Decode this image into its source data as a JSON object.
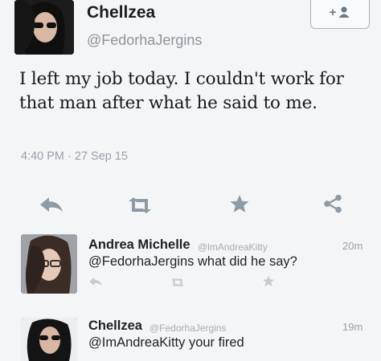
{
  "main_tweet": {
    "display_name": "Chellzea",
    "handle": "@FedorhaJergins",
    "follow_label": "+",
    "text": "I left my job today. I couldn't work for that man after what he said to me.",
    "timestamp": "4:40 PM · 27 Sep 15",
    "actions": [
      "reply-icon",
      "retweet-icon",
      "favorite-icon",
      "share-icon"
    ]
  },
  "replies": [
    {
      "display_name": "Andrea Michelle",
      "handle": "@lmAndreaKitty",
      "text": "@FedorhaJergins what did he say?",
      "time": "20m"
    },
    {
      "display_name": "Chellzea",
      "handle": "@FedorhaJergins",
      "text": "@ImAndreaKitty your fired",
      "time": "19m"
    }
  ],
  "colors": {
    "background": "#f4f5f7",
    "text": "#16181a",
    "muted": "#98a2aa",
    "icon": "#8e9aa4"
  }
}
